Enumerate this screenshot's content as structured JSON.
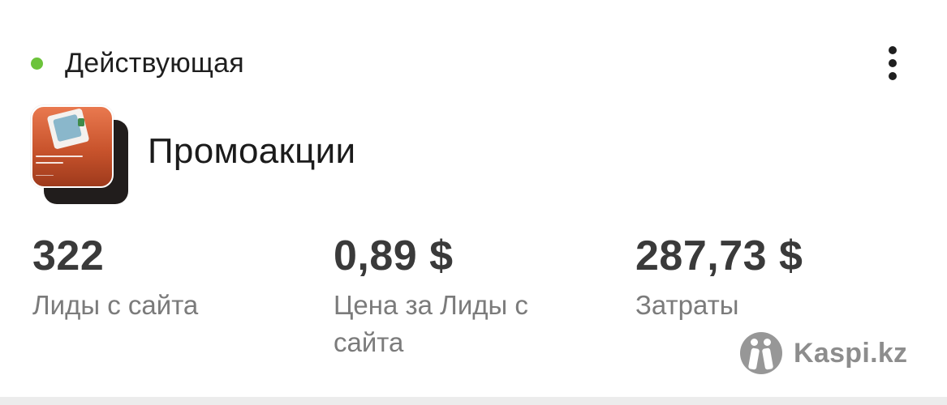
{
  "status": {
    "label": "Действующая",
    "color": "#6cc33a",
    "dot_icon": "status-dot-icon"
  },
  "menu": {
    "icon": "more-vertical-icon"
  },
  "campaign": {
    "title": "Промоакции",
    "thumbnail": "ad-creative-thumbnail"
  },
  "metrics": [
    {
      "value": "322",
      "label": "Лиды с сайта"
    },
    {
      "value": "0,89 $",
      "label": "Цена за Лиды с сайта"
    },
    {
      "value": "287,73 $",
      "label": "Затраты"
    }
  ],
  "watermark": {
    "text": "Kaspi.kz",
    "logo": "kaspi-logo-icon"
  },
  "colors": {
    "text_primary": "#1e1e1e",
    "text_value": "#3a3a3a",
    "text_secondary": "#7b7b7b",
    "background": "#ffffff"
  }
}
